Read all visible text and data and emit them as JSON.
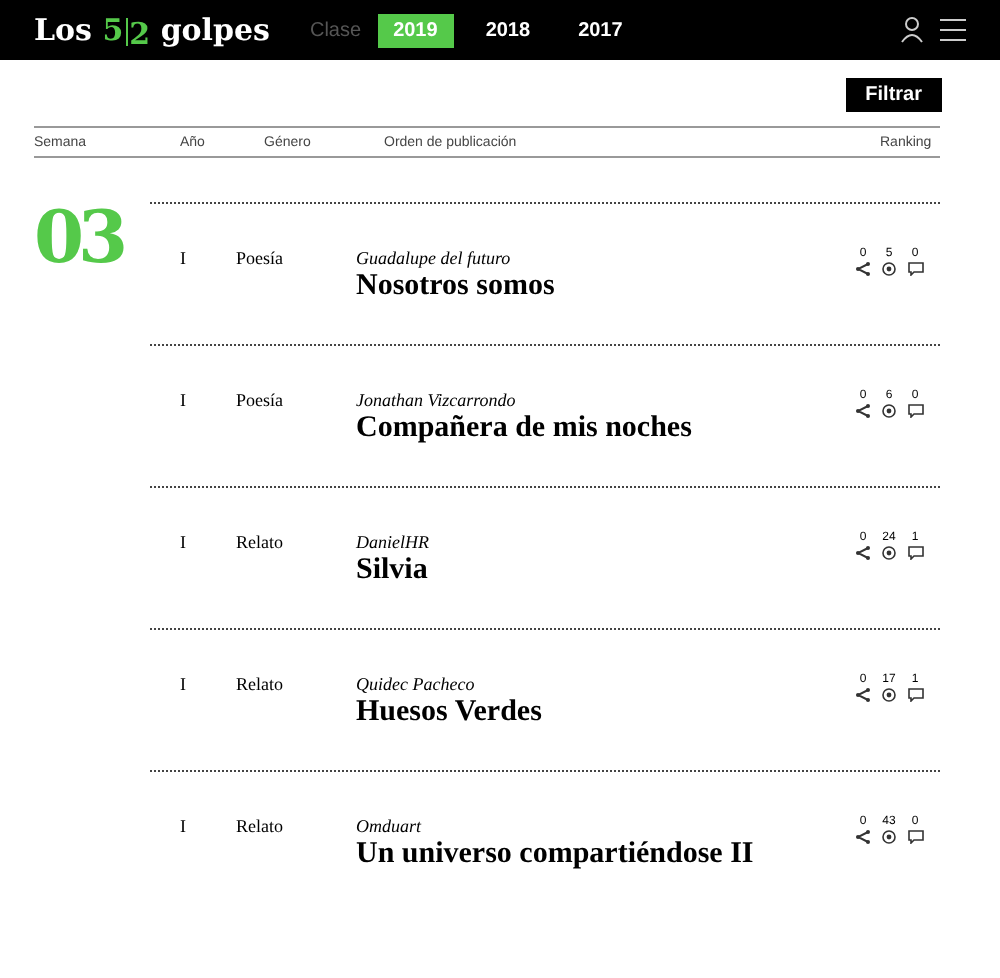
{
  "header": {
    "logo": {
      "before": "Los",
      "accent_1": "5",
      "accent_2": "2",
      "after": "golpes"
    },
    "class_label": "Clase",
    "tabs": [
      {
        "label": "2019",
        "selected": true
      },
      {
        "label": "2018",
        "selected": false
      },
      {
        "label": "2017",
        "selected": false
      }
    ]
  },
  "filter_button": "Filtrar",
  "columns": [
    "Semana",
    "Año",
    "Género",
    "Orden de publicación",
    "Ranking"
  ],
  "week": "03",
  "rows": [
    {
      "year": "I",
      "genre": "Poesía",
      "author": "Guadalupe del futuro",
      "title": "Nosotros somos",
      "shares": "0",
      "views": "5",
      "comments": "0"
    },
    {
      "year": "I",
      "genre": "Poesía",
      "author": "Jonathan Vizcarrondo",
      "title": "Compañera de mis noches",
      "shares": "0",
      "views": "6",
      "comments": "0"
    },
    {
      "year": "I",
      "genre": "Relato",
      "author": "DanielHR",
      "title": "Silvia",
      "shares": "0",
      "views": "24",
      "comments": "1"
    },
    {
      "year": "I",
      "genre": "Relato",
      "author": "Quidec Pacheco",
      "title": "Huesos Verdes",
      "shares": "0",
      "views": "17",
      "comments": "1"
    },
    {
      "year": "I",
      "genre": "Relato",
      "author": "Omduart",
      "title": "Un universo compartiéndose II",
      "shares": "0",
      "views": "43",
      "comments": "0"
    }
  ]
}
